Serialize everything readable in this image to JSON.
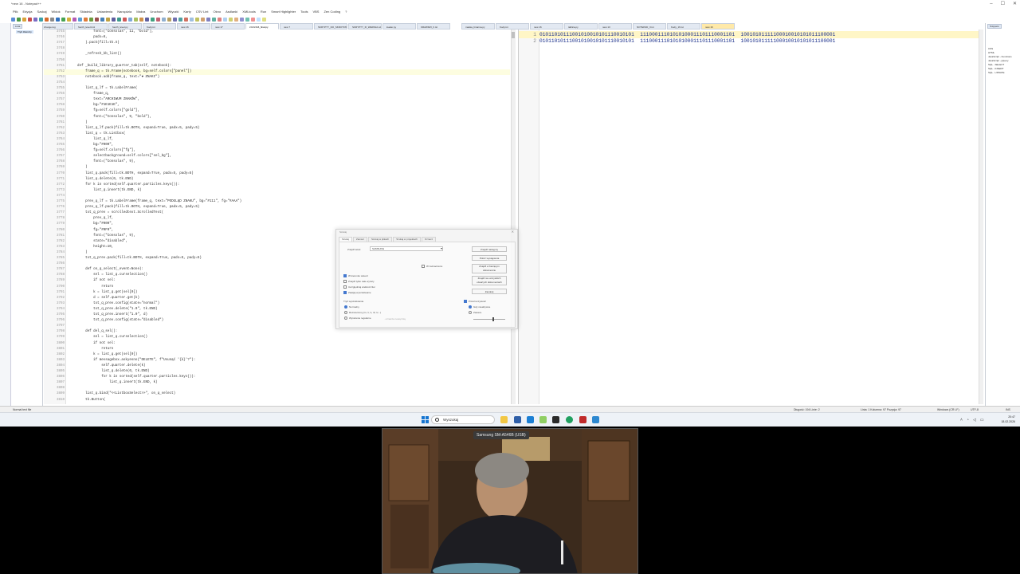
{
  "app": {
    "title": "*new 16 - Notepad++",
    "win_controls": [
      "–",
      "☐",
      "✕"
    ]
  },
  "menu": [
    "Plik",
    "Edycja",
    "Szukaj",
    "Widok",
    "Format",
    "Składnia",
    "Ustawienia",
    "Narzędzia",
    "Makra",
    "Uruchom",
    "Wtyczki",
    "Karty",
    "CSV Lint",
    "Okno",
    "Asdlanki",
    "XMLtools",
    "Run",
    "Smart Highlighter",
    "Tools",
    "VBS",
    "Zen Coding",
    "?"
  ],
  "tabs": [
    {
      "label": "change.log",
      "active": false
    },
    {
      "label": "fourth_level.kml",
      "active": false
    },
    {
      "label": "fourth_level.py",
      "active": false
    },
    {
      "label": "Kody.txt",
      "active": false
    },
    {
      "label": "new 16",
      "active": false
    },
    {
      "label": "new 17",
      "active": false
    },
    {
      "label": "zzzzzz16_final.py",
      "active": true
    },
    {
      "label": "new 7",
      "active": false
    },
    {
      "label": "SKRYPTY_DO_SKROTOW.txt",
      "active": false
    },
    {
      "label": "SKRYPTY_III_WERSJA.txt",
      "active": false
    },
    {
      "label": "loader.py",
      "active": false
    },
    {
      "label": "KRAWDZI_II.txt",
      "active": false
    }
  ],
  "tabs2": [
    "maska_binarna.py",
    "Kody.txt",
    "new 16",
    "tablica.py",
    "new 13",
    "NOTEPAD_II.txt",
    "Kody_16.txt",
    "new 16"
  ],
  "left_panel": {
    "tab": "Lista",
    "item": "Tryb zbiorczy"
  },
  "editor_lines": [
    {
      "n": "3745",
      "t": "            font=(\"Consolas\", 11, \"bold\"),"
    },
    {
      "n": "3746",
      "t": "            padx=6,"
    },
    {
      "n": "3747",
      "t": "        ).pack(fill=tk.X)"
    },
    {
      "n": "3748",
      "t": ""
    },
    {
      "n": "3749",
      "t": "        _refresh_kb_list()"
    },
    {
      "n": "3750",
      "t": ""
    },
    {
      "n": "3751",
      "t": "    def _build_library_quarter_tab(self, notebook):"
    },
    {
      "n": "3752",
      "t": "        frame_q = tk.Frame(notebook, bg=self.colors[\"panel\"])"
    },
    {
      "n": "3753",
      "t": "        notebook.add(frame_q, text=\"♥ ZNAKI\")"
    },
    {
      "n": "3754",
      "t": ""
    },
    {
      "n": "3755",
      "t": "        list_q_lf = tk.LabelFrame("
    },
    {
      "n": "3756",
      "t": "            frame_q,"
    },
    {
      "n": "3757",
      "t": "            text=\"ARCHIWUM ZNAKÓW\","
    },
    {
      "n": "3758",
      "t": "            bg=\"#1E1E1E\","
    },
    {
      "n": "3759",
      "t": "            fg=self.colors[\"gold\"],"
    },
    {
      "n": "3760",
      "t": "            font=(\"Consolas\", 9, \"bold\"),"
    },
    {
      "n": "3761",
      "t": "        )"
    },
    {
      "n": "3762",
      "t": "        list_q_lf.pack(fill=tk.BOTH, expand=True, padx=5, pady=5)"
    },
    {
      "n": "3763",
      "t": "        list_q = tk.Listbox("
    },
    {
      "n": "3764",
      "t": "            list_q_lf,"
    },
    {
      "n": "3765",
      "t": "            bg=\"#000\","
    },
    {
      "n": "3766",
      "t": "            fg=self.colors[\"fg\"],"
    },
    {
      "n": "3767",
      "t": "            selectbackground=self.colors[\"sel_bg\"],"
    },
    {
      "n": "3768",
      "t": "            font=(\"Consolas\", 9),"
    },
    {
      "n": "3769",
      "t": "        )"
    },
    {
      "n": "3770",
      "t": "        list_q.pack(fill=tk.BOTH, expand=True, padx=5, pady=5)"
    },
    {
      "n": "3771",
      "t": "        list_q.delete(0, tk.END)"
    },
    {
      "n": "3772",
      "t": "        for k in sorted(self.quarter.particles.keys()):"
    },
    {
      "n": "3773",
      "t": "            list_q.insert(tk.END, k)"
    },
    {
      "n": "3774",
      "t": ""
    },
    {
      "n": "3775",
      "t": "        prev_q_lf = tk.LabelFrame(frame_q, text=\"PODGLĄD ZNAKU\", bg=\"#111\", fg=\"#AAA\")"
    },
    {
      "n": "3776",
      "t": "        prev_q_lf.pack(fill=tk.BOTH, expand=True, padx=5, pady=5)"
    },
    {
      "n": "3777",
      "t": "        txt_q_prev = scrolledtext.ScrolledText("
    },
    {
      "n": "3778",
      "t": "            prev_q_lf,"
    },
    {
      "n": "3779",
      "t": "            bg=\"#000\","
    },
    {
      "n": "3780",
      "t": "            fg=\"#0F0\","
    },
    {
      "n": "3781",
      "t": "            font=(\"Consolas\", 9),"
    },
    {
      "n": "3782",
      "t": "            state=\"disabled\","
    },
    {
      "n": "3783",
      "t": "            height=10,"
    },
    {
      "n": "3784",
      "t": "        )"
    },
    {
      "n": "3785",
      "t": "        txt_q_prev.pack(fill=tk.BOTH, expand=True, padx=5, pady=5)"
    },
    {
      "n": "3786",
      "t": ""
    },
    {
      "n": "3787",
      "t": "        def on_q_select(_event=None):"
    },
    {
      "n": "3788",
      "t": "            sel = list_q.curselection()"
    },
    {
      "n": "3789",
      "t": "            if not sel:"
    },
    {
      "n": "3790",
      "t": "                return"
    },
    {
      "n": "3791",
      "t": "            k = list_q.get(sel[0])"
    },
    {
      "n": "3792",
      "t": "            d = self.quarter.get(k)"
    },
    {
      "n": "3793",
      "t": "            txt_q_prev.config(state=\"normal\")"
    },
    {
      "n": "3794",
      "t": "            txt_q_prev.delete(\"1.0\", tk.END)"
    },
    {
      "n": "3795",
      "t": "            txt_q_prev.insert(\"1.0\", d)"
    },
    {
      "n": "3796",
      "t": "            txt_q_prev.config(state=\"disabled\")"
    },
    {
      "n": "3797",
      "t": ""
    },
    {
      "n": "3798",
      "t": "        def del_q_sel():"
    },
    {
      "n": "3799",
      "t": "            sel = list_q.curselection()"
    },
    {
      "n": "3800",
      "t": "            if not sel:"
    },
    {
      "n": "3801",
      "t": "                return"
    },
    {
      "n": "3802",
      "t": "            k = list_q.get(sel[0])"
    },
    {
      "n": "3803",
      "t": "            if messagebox.askyesno(\"DELETE\", f\"Usunąć '{k}'?\"):"
    },
    {
      "n": "3804",
      "t": "                self.quarter.delete(k)"
    },
    {
      "n": "3805",
      "t": "                list_q.delete(0, tk.END)"
    },
    {
      "n": "3806",
      "t": "                for k in sorted(self.quarter.particles.keys()):"
    },
    {
      "n": "3807",
      "t": "                    list_q.insert(tk.END, k)"
    },
    {
      "n": "3808",
      "t": ""
    },
    {
      "n": "3809",
      "t": "        list_q.bind(\"<<ListboxSelect>>\", on_q_select)"
    },
    {
      "n": "3810",
      "t": "        tk.Button("
    }
  ],
  "binary_lines": [
    {
      "n": "1",
      "t": "01011010111001010010101110010101  11100011101010100011101110001101  10010101111100010010101011100001"
    },
    {
      "n": "2",
      "t": "01011010111001010010101110010101  11100011101010100011101110001101  10010101111100010010101011100001"
    }
  ],
  "dialog": {
    "title": "Szukaj",
    "close": "✕",
    "tabs": [
      "Szukaj",
      "Zamień",
      "Szukaj w plikach",
      "Szukaj w projektach",
      "Oznacz"
    ],
    "find_label": "Znajdź tekst:",
    "find_value": "SAMSUNG",
    "buttons": [
      "Znajdź następny",
      "Policz wystąpienia",
      "Znajdź w bieżącym dokumencie",
      "Znajdź we wszystkich otwartych dokumentach",
      "Zamknij"
    ],
    "in_selection": "W zaznaczeniu",
    "checkboxes": [
      {
        "label": "W kierunku wstecz",
        "on": true
      },
      {
        "label": "Znajdź tylko całe wyrazy",
        "on": false
      },
      {
        "label": "Uwzględniaj wielkość liter",
        "on": false
      },
      {
        "label": "Zawijaj wyszukiwanie",
        "on": true
      }
    ],
    "mode_title": "Tryb wyszukiwania",
    "modes": [
      {
        "label": "Normalny",
        "on": true
      },
      {
        "label": "Rozszerzony (\\n, \\r, \\t, \\0, \\x...)",
        "on": false
      },
      {
        "label": "Wyrażenie regularne",
        "on": false
      }
    ],
    "transparency_title": "Przezroczystość",
    "transparency": [
      {
        "label": "Gdy nieaktywne",
        "on": true
      },
      {
        "label": "Zawsze",
        "on": false
      }
    ],
    "dot_newline": ". oznacza nową linię"
  },
  "right_panel": {
    "tab": "Snippets",
    "items": [
      "CSS",
      "HTML",
      "JavaScript - Functions",
      "JavaScript - jQuery",
      "SQL - SELECT",
      "SQL - INSERT",
      "SQL - UPDATE"
    ]
  },
  "status": {
    "left": "Normal text file",
    "length": "Długość: 194   Linie: 2",
    "pos": "Linia: 1   Kolumna: 97   Pozycja: 97",
    "eol": "Windows (CR LF)",
    "enc": "UTF-8",
    "ins": "INS"
  },
  "taskbar": {
    "search_placeholder": "Wyszukaj",
    "time": "20:47",
    "date": "18.02.2026"
  },
  "webcam": {
    "label": "Samsung SM-A546B (USB)"
  }
}
